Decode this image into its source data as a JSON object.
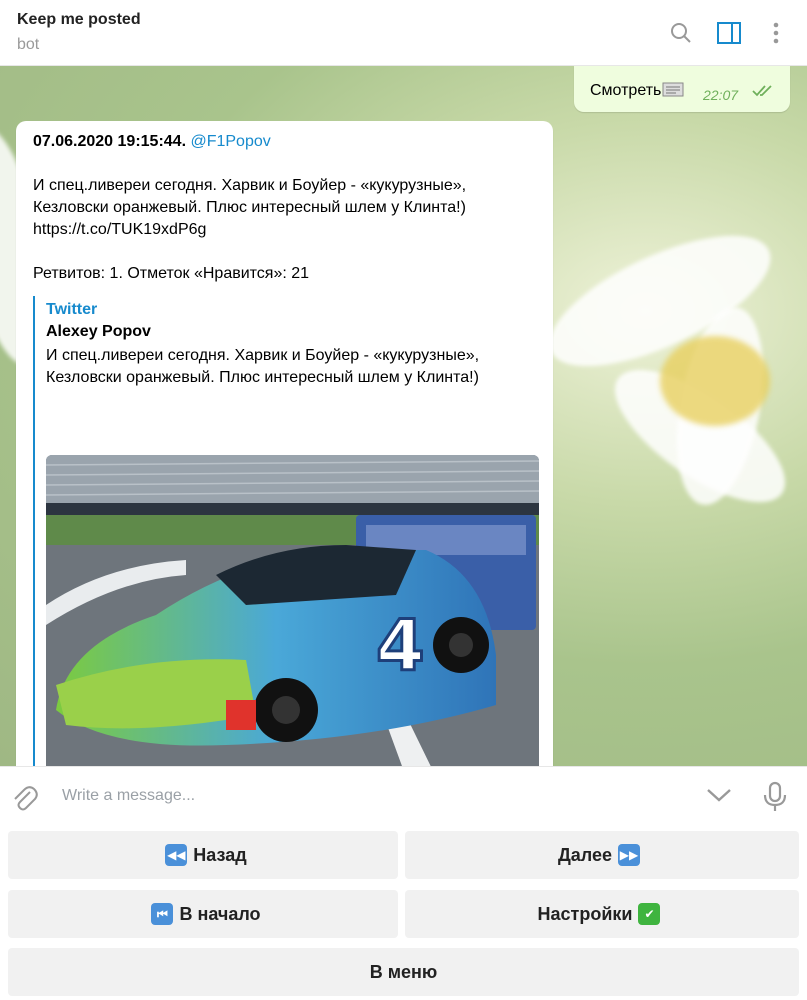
{
  "header": {
    "title": "Keep me posted",
    "subtitle": "bot",
    "icons": [
      "search-icon",
      "sidebar-toggle-icon",
      "more-vertical-icon"
    ],
    "accent": "#168acd"
  },
  "outgoing": {
    "text": "Смотреть",
    "time": "22:07"
  },
  "message": {
    "date_line": "07.06.2020 19:15:44.",
    "handle": "@F1Popov",
    "body_line1": "И спец.ливереи сегодня. Харвик и Боуйер - «кукурузные»,",
    "body_line2": "Кезловски оранжевый. Плюс интересный шлем у Клинта!)",
    "link": "https://t.co/TUK19xdP6g",
    "stats": "Ретвитов: 1. Отметок «Нравится»: 21",
    "preview": {
      "site": "Twitter",
      "title": "Alexey Popov",
      "desc_line1": "И спец.ливереи сегодня. Харвик и Боуйер - «кукурузные»,",
      "desc_line2": "Кезловски оранжевый. Плюс интересный шлем у Клинта!)"
    }
  },
  "composer": {
    "placeholder": "Write a message..."
  },
  "keyboard": {
    "back": "Назад",
    "next": "Далее",
    "start": "В начало",
    "settings": "Настройки",
    "menu": "В меню"
  }
}
